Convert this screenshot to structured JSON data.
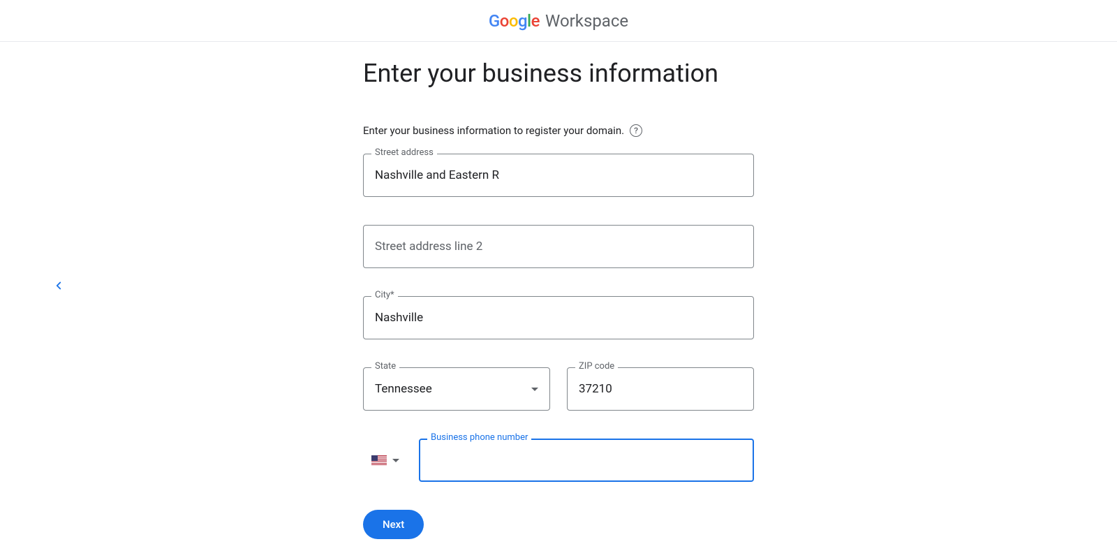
{
  "header": {
    "brand": "Google",
    "product": "Workspace"
  },
  "page": {
    "title": "Enter your business information",
    "subtitle": "Enter your business information to register your domain."
  },
  "fields": {
    "street": {
      "label": "Street address",
      "value": "Nashville and Eastern R"
    },
    "street2": {
      "placeholder": "Street address line 2",
      "value": ""
    },
    "city": {
      "label": "City*",
      "value": "Nashville"
    },
    "state": {
      "label": "State",
      "value": "Tennessee"
    },
    "zip": {
      "label": "ZIP code",
      "value": "37210"
    },
    "phone": {
      "label": "Business phone number",
      "value": ""
    }
  },
  "buttons": {
    "next": "Next"
  }
}
